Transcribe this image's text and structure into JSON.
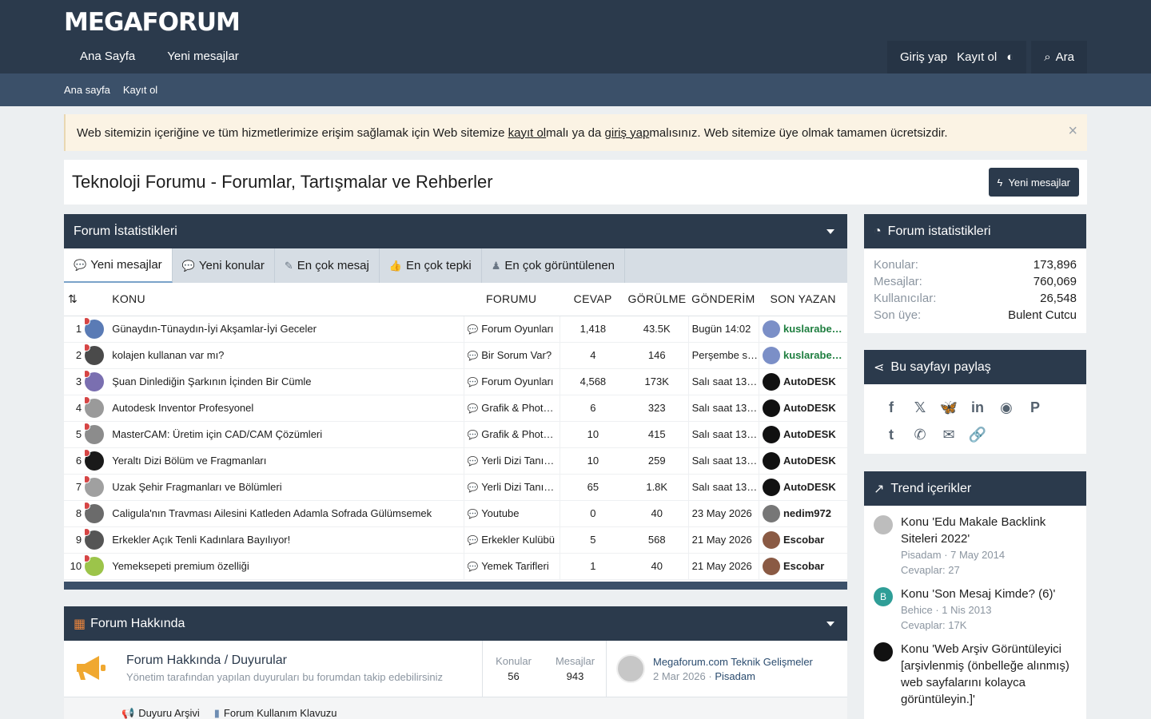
{
  "header": {
    "logo": "MEGAFORUM",
    "nav": [
      "Ana Sayfa",
      "Yeni mesajlar"
    ],
    "login": "Giriş yap",
    "register": "Kayıt ol",
    "search": "Ara",
    "sub": [
      "Ana sayfa",
      "Kayıt ol"
    ]
  },
  "notice": {
    "t1": "Web sitemizin içeriğine ve tüm hizmetlerimize erişim sağlamak için Web sitemize ",
    "l1": "kayıt ol",
    "t2": "malı ya da ",
    "l2": "giriş yap",
    "t3": "malısınız. Web sitemize üye olmak tamamen ücretsizdir."
  },
  "page": {
    "title": "Teknoloji Forumu - Forumlar, Tartışmalar ve Rehberler",
    "new_posts_btn": "Yeni mesajlar"
  },
  "stats": {
    "title": "Forum İstatistikleri",
    "tabs": [
      "Yeni mesajlar",
      "Yeni konular",
      "En çok mesaj",
      "En çok tepki",
      "En çok görüntülenen"
    ],
    "cols": [
      "KONU",
      "FORUMU",
      "CEVAP",
      "GÖRÜLME",
      "GÖNDERİM",
      "SON YAZAN"
    ],
    "rows": [
      {
        "n": "1",
        "title": "Günaydın-Tünaydın-İyi Akşamlar-İyi Geceler",
        "forum": "Forum Oyunları",
        "rep": "1,418",
        "views": "43.5K",
        "date": "Bugün 14:02",
        "last": "kuslarabe…",
        "green": true
      },
      {
        "n": "2",
        "title": "kolajen kullanan var mı?",
        "forum": "Bir Sorum Var?",
        "rep": "4",
        "views": "146",
        "date": "Perşembe s…",
        "last": "kuslarabe…",
        "green": true
      },
      {
        "n": "3",
        "title": "Şuan Dinlediğin Şarkının İçinden Bir Cümle",
        "forum": "Forum Oyunları",
        "rep": "4,568",
        "views": "173K",
        "date": "Salı saat 13…",
        "last": "AutoDESK",
        "green": false
      },
      {
        "n": "4",
        "title": "Autodesk Inventor Profesyonel",
        "forum": "Grafik & Phot…",
        "rep": "6",
        "views": "323",
        "date": "Salı saat 13…",
        "last": "AutoDESK",
        "green": false
      },
      {
        "n": "5",
        "title": "MasterCAM: Üretim için CAD/CAM Çözümleri",
        "forum": "Grafik & Phot…",
        "rep": "10",
        "views": "415",
        "date": "Salı saat 13…",
        "last": "AutoDESK",
        "green": false
      },
      {
        "n": "6",
        "title": "Yeraltı Dizi Bölüm ve Fragmanları",
        "forum": "Yerli Dizi Tanı…",
        "rep": "10",
        "views": "259",
        "date": "Salı saat 13…",
        "last": "AutoDESK",
        "green": false
      },
      {
        "n": "7",
        "title": "Uzak Şehir Fragmanları ve Bölümleri",
        "forum": "Yerli Dizi Tanı…",
        "rep": "65",
        "views": "1.8K",
        "date": "Salı saat 13…",
        "last": "AutoDESK",
        "green": false
      },
      {
        "n": "8",
        "title": "Caligula'nın Travması Ailesini Katleden Adamla Sofrada Gülümsemek",
        "forum": "Youtube",
        "rep": "0",
        "views": "40",
        "date": "23 May 2026",
        "last": "nedim972",
        "green": false
      },
      {
        "n": "9",
        "title": "Erkekler Açık Tenli Kadınlara Bayılıyor!",
        "forum": "Erkekler Kulübü",
        "rep": "5",
        "views": "568",
        "date": "21 May 2026",
        "last": "Escobar",
        "green": false
      },
      {
        "n": "10",
        "title": "Yemeksepeti premium özelliği",
        "forum": "Yemek Tarifleri",
        "rep": "1",
        "views": "40",
        "date": "21 May 2026",
        "last": "Escobar",
        "green": false
      }
    ]
  },
  "about": {
    "title": "Forum Hakkında",
    "forum_title": "Forum Hakkında / Duyurular",
    "forum_desc": "Yönetim tarafından yapılan duyuruları bu forumdan takip edebilirsiniz",
    "topics_label": "Konular",
    "topics": "56",
    "posts_label": "Mesajlar",
    "posts": "943",
    "last_title": "Megaforum.com Teknik Gelişmeler",
    "last_date": "2 Mar 2026",
    "last_user": "Pisadam",
    "sub": [
      "Duyuru Arşivi",
      "Forum Kullanım Klavuzu"
    ]
  },
  "side_stats": {
    "title": "Forum istatistikleri",
    "rows": [
      {
        "k": "Konular:",
        "v": "173,896"
      },
      {
        "k": "Mesajlar:",
        "v": "760,069"
      },
      {
        "k": "Kullanıcılar:",
        "v": "26,548"
      },
      {
        "k": "Son üye:",
        "v": "Bulent Cutcu"
      }
    ]
  },
  "share": {
    "title": "Bu sayfayı paylaş"
  },
  "trend": {
    "title": "Trend içerikler",
    "items": [
      {
        "t": "Konu 'Edu Makale Backlink Siteleri 2022'",
        "m1": "Pisadam · 7 May 2014",
        "m2": "Cevaplar: 27"
      },
      {
        "t": "Konu 'Son Mesaj Kimde? (6)'",
        "m1": "Behice · 1 Nis 2013",
        "m2": "Cevaplar: 17K"
      },
      {
        "t": "Konu 'Web Arşiv Görüntüleyici [arşivlenmiş (önbelleğe alınmış) web sayfalarını kolayca görüntüleyin.]'",
        "m1": "",
        "m2": ""
      }
    ]
  }
}
